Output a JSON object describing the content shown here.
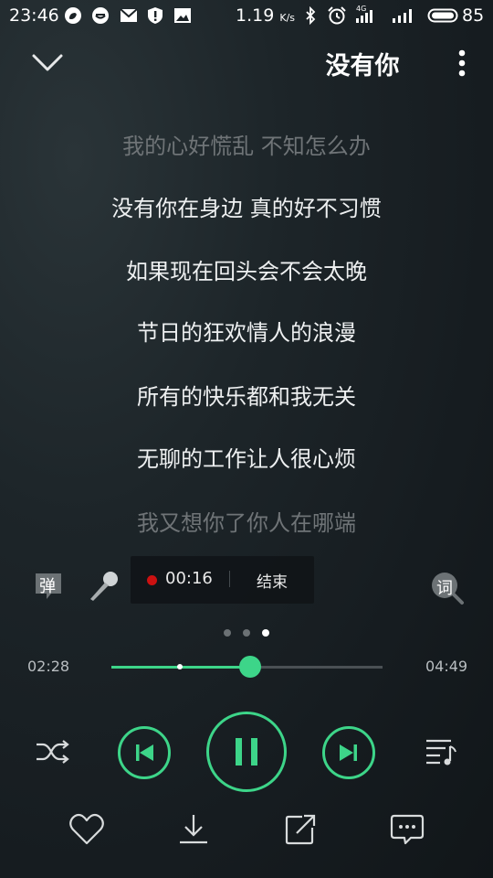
{
  "status_bar": {
    "time": "23:46",
    "net_speed": "1.19",
    "net_speed_unit": "K/s",
    "net_type": "4G",
    "battery": "85",
    "icons": [
      "weibo-icon",
      "qq-icon",
      "mail-icon",
      "shield-icon",
      "image-icon",
      "bluetooth-icon",
      "alarm-icon",
      "signal-icon",
      "battery-icon"
    ]
  },
  "header": {
    "title": "没有你",
    "back_icon": "chevron-down-icon",
    "menu_icon": "more-vertical-icon"
  },
  "lyrics": [
    {
      "text": "我的心好慌乱 不知怎么办",
      "active": false
    },
    {
      "text": "没有你在身边 真的好不习惯",
      "active": true
    },
    {
      "text": "如果现在回头会不会太晚",
      "active": true
    },
    {
      "text": "节日的狂欢情人的浪漫",
      "active": true
    },
    {
      "text": "所有的快乐都和我无关",
      "active": true
    },
    {
      "text": "无聊的工作让人很心烦",
      "active": true
    },
    {
      "text": "我又想你了你人在哪端",
      "active": false
    }
  ],
  "tools": {
    "danmaku_label": "弹",
    "lyrics_label": "词",
    "microphone_icon": "microphone-icon",
    "recording": {
      "elapsed": "00:16",
      "end_label": "结束"
    }
  },
  "pager": {
    "count": 3,
    "active_index": 2
  },
  "progress": {
    "current_time": "02:28",
    "total_time": "04:49",
    "played_fraction": 0.512,
    "buffered_fraction": 0.253
  },
  "controls": {
    "shuffle_icon": "shuffle-icon",
    "prev_icon": "skip-previous-icon",
    "pause_icon": "pause-icon",
    "next_icon": "skip-next-icon",
    "playlist_icon": "playlist-icon"
  },
  "bottom_actions": {
    "like_icon": "heart-icon",
    "download_icon": "download-icon",
    "share_icon": "share-icon",
    "comment_icon": "comment-icon"
  },
  "colors": {
    "accent": "#3dd589",
    "record_dot": "#cc1111",
    "text_dim": "#6f7477"
  }
}
